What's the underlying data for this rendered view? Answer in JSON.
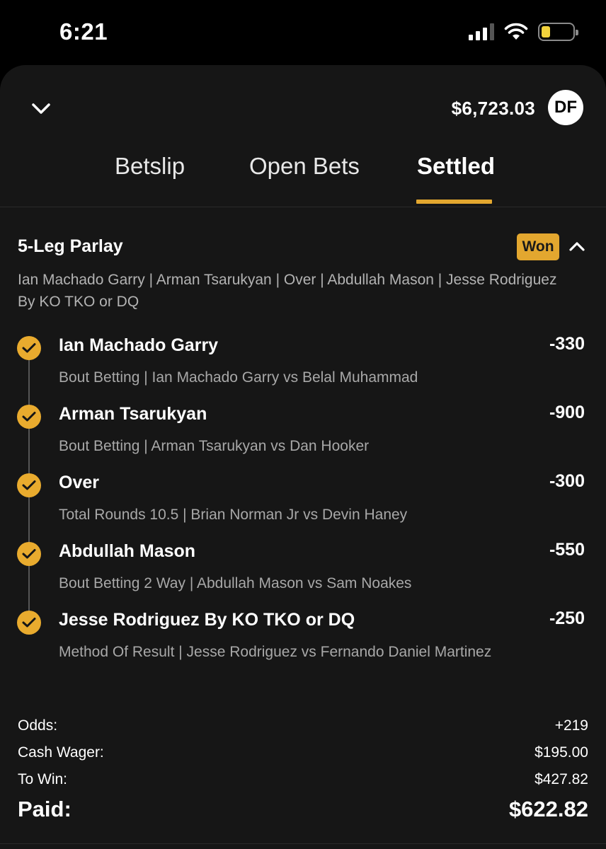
{
  "status_bar": {
    "time": "6:21",
    "signal_icon": "cellular-signal-icon",
    "wifi_icon": "wifi-icon",
    "battery_icon": "battery-icon"
  },
  "header": {
    "balance": "$6,723.03",
    "avatar_initials": "DF",
    "collapse_icon": "chevron-down-icon"
  },
  "tabs": [
    {
      "label": "Betslip",
      "active": false
    },
    {
      "label": "Open Bets",
      "active": false
    },
    {
      "label": "Settled",
      "active": true
    }
  ],
  "accent_color": "#e3a72f",
  "bet": {
    "title": "5-Leg Parlay",
    "status": "Won",
    "summary": "Ian Machado Garry | Arman Tsarukyan | Over | Abdullah Mason | Jesse Rodriguez By KO TKO or DQ",
    "legs": [
      {
        "name": "Ian Machado Garry",
        "odds": "-330",
        "description": "Bout Betting | Ian Machado Garry vs Belal Muhammad"
      },
      {
        "name": "Arman Tsarukyan",
        "odds": "-900",
        "description": "Bout Betting | Arman Tsarukyan vs Dan Hooker"
      },
      {
        "name": "Over",
        "odds": "-300",
        "description": "Total Rounds 10.5 | Brian Norman Jr vs Devin Haney"
      },
      {
        "name": "Abdullah Mason",
        "odds": "-550",
        "description": "Bout Betting 2 Way | Abdullah Mason vs Sam Noakes"
      },
      {
        "name": "Jesse Rodriguez By KO TKO or DQ",
        "odds": "-250",
        "description": "Method Of Result | Jesse Rodriguez vs Fernando Daniel Martinez"
      }
    ],
    "odds_label": "Odds:",
    "odds_value": "+219",
    "wager_label": "Cash Wager:",
    "wager_value": "$195.00",
    "to_win_label": "To Win:",
    "to_win_value": "$427.82",
    "paid_label": "Paid:",
    "paid_value": "$622.82"
  }
}
